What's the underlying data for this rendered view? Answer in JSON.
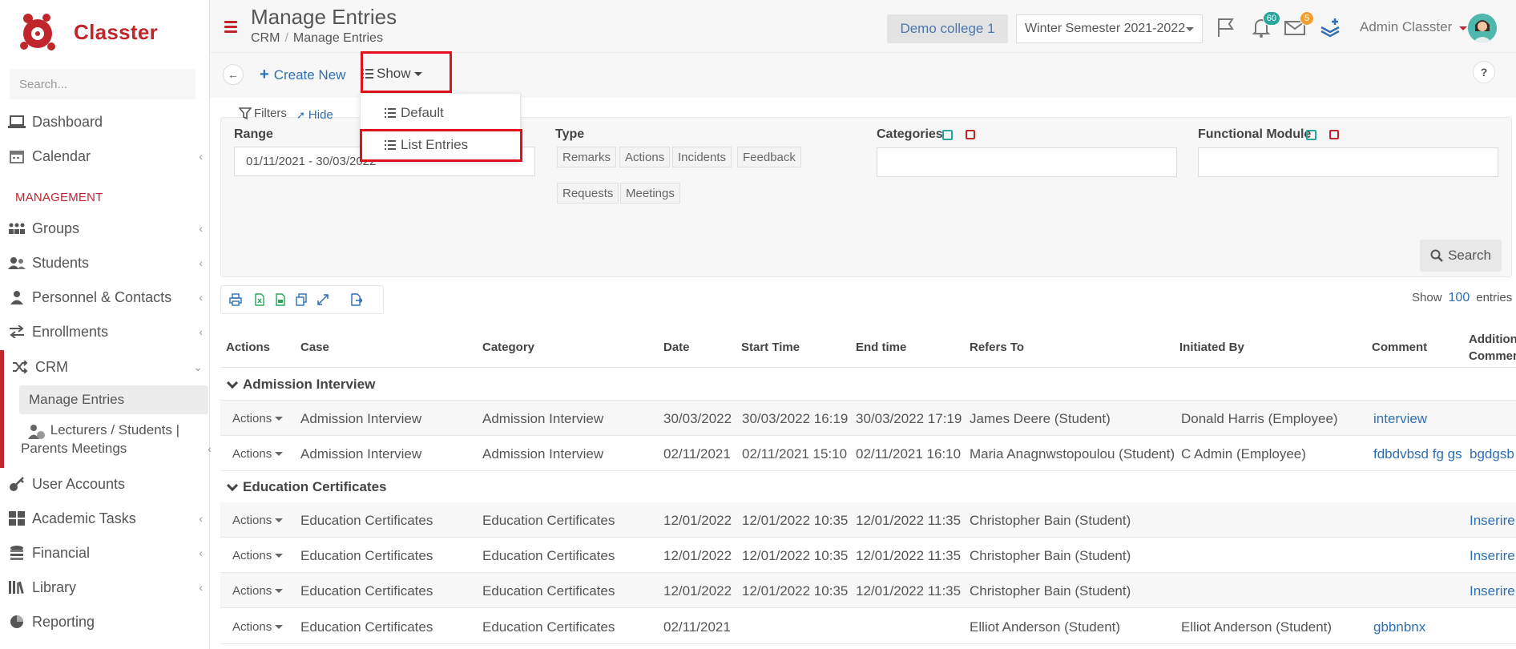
{
  "app": {
    "name": "Classter"
  },
  "sidebar": {
    "search_placeholder": "Search...",
    "items": [
      {
        "label": "Dashboard"
      },
      {
        "label": "Calendar"
      },
      {
        "label": "Groups"
      },
      {
        "label": "Students"
      },
      {
        "label": "Personnel & Contacts"
      },
      {
        "label": "Enrollments"
      },
      {
        "label": "CRM"
      },
      {
        "label": "User Accounts"
      },
      {
        "label": "Academic Tasks"
      },
      {
        "label": "Financial"
      },
      {
        "label": "Library"
      },
      {
        "label": "Reporting"
      }
    ],
    "section_management": "MANAGEMENT",
    "crm_sub": [
      {
        "label": "Manage Entries"
      },
      {
        "label": "Lecturers / Students |"
      },
      {
        "label": "Parents Meetings"
      }
    ]
  },
  "header": {
    "title": "Manage Entries",
    "breadcrumb": [
      "CRM",
      "Manage Entries"
    ],
    "breadcrumb_sep": "/",
    "college": "Demo college 1",
    "semester": "Winter Semester 2021-2022",
    "notifications_count": "60",
    "messages_count": "5",
    "user_name": "Admin Classter",
    "badge_colors": {
      "notifications": "#2aa59b",
      "messages": "#f0a030"
    }
  },
  "toolbar": {
    "create_label": "Create New",
    "show_label": "Show",
    "help_label": "?"
  },
  "show_menu": {
    "items": [
      {
        "label": "Default"
      },
      {
        "label": "List Entries"
      }
    ]
  },
  "filters": {
    "filters_label": "Filters",
    "hide_label": "Hide",
    "range_label": "Range",
    "range_value": "01/11/2021 - 30/03/2022",
    "type_label": "Type",
    "types": [
      "Remarks",
      "Actions",
      "Incidents",
      "Feedback",
      "Requests",
      "Meetings"
    ],
    "categories_label": "Categories",
    "functional_module_label": "Functional Module",
    "search_label": "Search"
  },
  "entries": {
    "show_label": "Show",
    "count": "100",
    "entries_label": "entries"
  },
  "table": {
    "columns": [
      "Actions",
      "Case",
      "Category",
      "Date",
      "Start Time",
      "End time",
      "Refers To",
      "Initiated By",
      "Comment",
      "Addition",
      "Commen"
    ],
    "actions_label": "Actions",
    "groups": [
      {
        "name": "Admission Interview",
        "rows": [
          {
            "case": "Admission Interview",
            "category": "Admission Interview",
            "date": "30/03/2022",
            "start": "30/03/2022 16:19",
            "end": "30/03/2022 17:19",
            "refers": "James Deere (Student)",
            "initiated": "Donald Harris (Employee)",
            "comment": "interview",
            "additional": ""
          },
          {
            "case": "Admission Interview",
            "category": "Admission Interview",
            "date": "02/11/2021",
            "start": "02/11/2021 15:10",
            "end": "02/11/2021 16:10",
            "refers": "Maria Anagnwstopoulou (Student)",
            "initiated": "C Admin (Employee)",
            "comment": "fdbdvbsd fg gs",
            "additional": "bgdgsb"
          }
        ]
      },
      {
        "name": "Education Certificates",
        "rows": [
          {
            "case": "Education Certificates",
            "category": "Education Certificates",
            "date": "12/01/2022",
            "start": "12/01/2022 10:35",
            "end": "12/01/2022 11:35",
            "refers": "Christopher Bain (Student)",
            "initiated": "",
            "comment": "",
            "additional": "Inserire"
          },
          {
            "case": "Education Certificates",
            "category": "Education Certificates",
            "date": "12/01/2022",
            "start": "12/01/2022 10:35",
            "end": "12/01/2022 11:35",
            "refers": "Christopher Bain (Student)",
            "initiated": "",
            "comment": "",
            "additional": "Inserire"
          },
          {
            "case": "Education Certificates",
            "category": "Education Certificates",
            "date": "12/01/2022",
            "start": "12/01/2022 10:35",
            "end": "12/01/2022 11:35",
            "refers": "Christopher Bain (Student)",
            "initiated": "",
            "comment": "",
            "additional": "Inserire"
          },
          {
            "case": "Education Certificates",
            "category": "Education Certificates",
            "date": "02/11/2021",
            "start": "",
            "end": "",
            "refers": "Elliot Anderson (Student)",
            "initiated": "Elliot Anderson (Student)",
            "comment": "gbbnbnx",
            "additional": ""
          }
        ]
      }
    ]
  },
  "colors": {
    "brand": "#c0272d",
    "link": "#2f6fb3",
    "highlight": "#e0111a",
    "accent": "#2aa59b"
  }
}
